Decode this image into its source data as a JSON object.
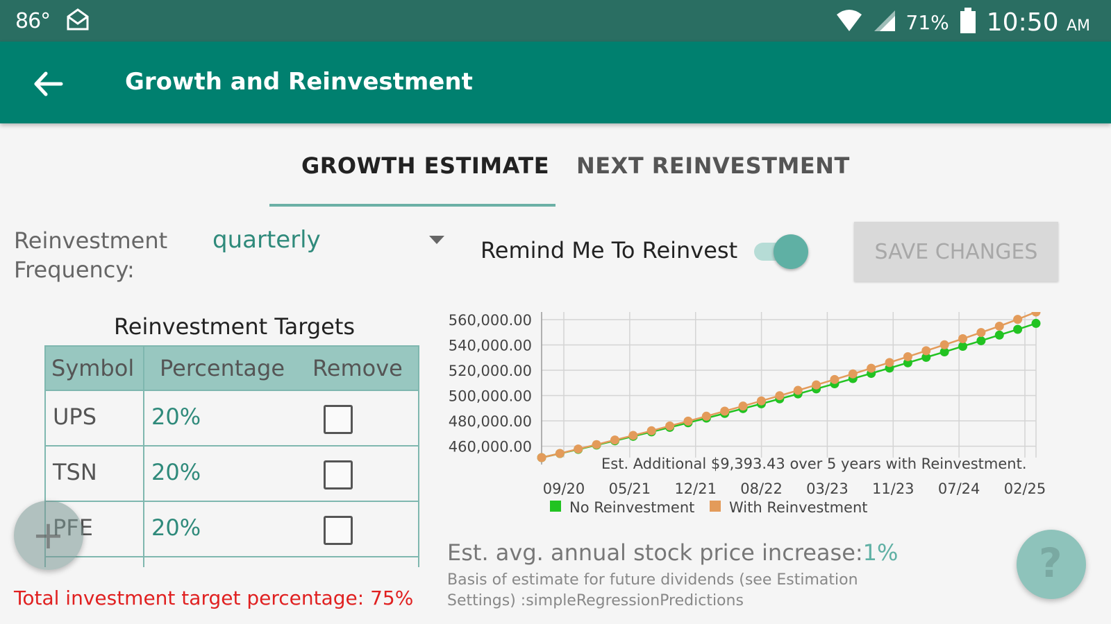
{
  "status_bar": {
    "temperature": "86°",
    "battery_percent": "71%",
    "time": "10:50",
    "ampm": "AM"
  },
  "app_bar": {
    "title": "Growth and Reinvestment"
  },
  "tabs": [
    {
      "label": "GROWTH ESTIMATE",
      "active": true
    },
    {
      "label": "NEXT REINVESTMENT",
      "active": false
    }
  ],
  "frequency": {
    "label_line1": "Reinvestment",
    "label_line2": "Frequency:",
    "value": "quarterly"
  },
  "remind": {
    "label": "Remind Me To Reinvest",
    "enabled": true
  },
  "save_button": {
    "label": "SAVE CHANGES"
  },
  "targets": {
    "title": "Reinvestment Targets",
    "headers": [
      "Symbol",
      "Percentage",
      "Remove"
    ],
    "rows": [
      {
        "symbol": "UPS",
        "percentage": "20%"
      },
      {
        "symbol": "TSN",
        "percentage": "20%"
      },
      {
        "symbol": "PFE",
        "percentage": "20%"
      }
    ],
    "total_text": "Total investment target percentage:  75%"
  },
  "chart_data": {
    "type": "line",
    "categories": [
      "09/20",
      "05/21",
      "12/21",
      "08/22",
      "03/23",
      "11/23",
      "07/24",
      "02/25"
    ],
    "y_ticks": [
      "460,000.00",
      "480,000.00",
      "500,000.00",
      "520,000.00",
      "540,000.00",
      "560,000.00"
    ],
    "ylim": [
      451000,
      566000
    ],
    "annotation": "Est. Additional $9,393.43 over 5 years with Reinvestment.",
    "grid": true,
    "legend_position": "bottom",
    "series": [
      {
        "name": "No Reinvestment",
        "color": "#22c322",
        "values": [
          451000,
          454200,
          457500,
          460900,
          464300,
          467800,
          471300,
          474900,
          478500,
          482200,
          485900,
          489700,
          493500,
          497400,
          501300,
          505300,
          509300,
          513400,
          517500,
          521700,
          525900,
          530200,
          534500,
          538900,
          543300,
          547800,
          552300,
          557000
        ]
      },
      {
        "name": "With Reinvestment",
        "color": "#e39b5a",
        "values": [
          451000,
          454300,
          457800,
          461300,
          464900,
          468500,
          472200,
          476000,
          479800,
          483700,
          487700,
          491700,
          495800,
          499900,
          504100,
          508400,
          512700,
          517100,
          521600,
          526100,
          530700,
          535400,
          540100,
          544900,
          549800,
          554800,
          560200,
          566000
        ]
      }
    ]
  },
  "estimate": {
    "avg_label": "Est. avg. annual stock price increase:",
    "avg_value": "1%",
    "basis_text": "Basis of estimate for future dividends (see Estimation Settings) :simpleRegressionPredictions"
  }
}
